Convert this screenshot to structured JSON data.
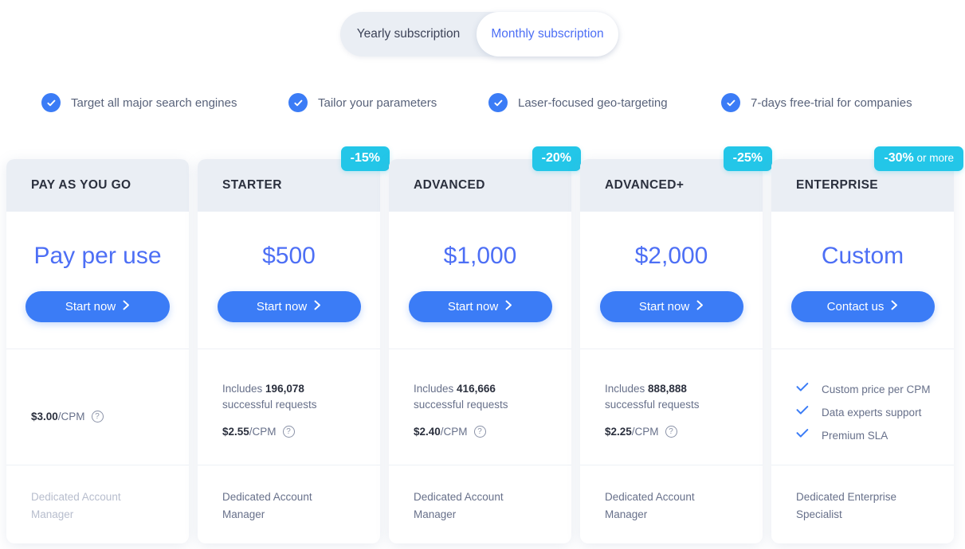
{
  "billing_toggle": {
    "options": [
      {
        "label": "Yearly subscription",
        "active": false
      },
      {
        "label": "Monthly subscription",
        "active": true
      }
    ]
  },
  "features": [
    {
      "icon": "check-circle-icon",
      "label": "Target all major search engines"
    },
    {
      "icon": "check-circle-icon",
      "label": "Tailor your parameters"
    },
    {
      "icon": "check-circle-icon",
      "label": "Laser-focused geo-targeting"
    },
    {
      "icon": "check-circle-icon",
      "label": "7-days free-trial for companies"
    }
  ],
  "plans": [
    {
      "name": "PAY AS YOU GO",
      "badge": null,
      "badge_suffix": null,
      "price": "Pay per use",
      "cta": "Start now",
      "includes_prefix": null,
      "includes_amount": null,
      "includes_suffix": null,
      "cpm_price": "$3.00",
      "cpm_unit": "/CPM",
      "footer": "Dedicated Account Manager",
      "footer_disabled": true
    },
    {
      "name": "STARTER",
      "badge": "-15%",
      "badge_suffix": null,
      "price": "$500",
      "cta": "Start now",
      "includes_prefix": "Includes ",
      "includes_amount": "196,078",
      "includes_suffix": "successful requests",
      "cpm_price": "$2.55",
      "cpm_unit": "/CPM",
      "footer": "Dedicated Account Manager",
      "footer_disabled": false
    },
    {
      "name": "ADVANCED",
      "badge": "-20%",
      "badge_suffix": null,
      "price": "$1,000",
      "cta": "Start now",
      "includes_prefix": "Includes ",
      "includes_amount": "416,666",
      "includes_suffix": "successful requests",
      "cpm_price": "$2.40",
      "cpm_unit": "/CPM",
      "footer": "Dedicated Account Manager",
      "footer_disabled": false
    },
    {
      "name": "ADVANCED+",
      "badge": "-25%",
      "badge_suffix": null,
      "price": "$2,000",
      "cta": "Start now",
      "includes_prefix": "Includes ",
      "includes_amount": "888,888",
      "includes_suffix": "successful requests",
      "cpm_price": "$2.25",
      "cpm_unit": "/CPM",
      "footer": "Dedicated Account Manager",
      "footer_disabled": false
    },
    {
      "name": "ENTERPRISE",
      "badge": "-30%",
      "badge_suffix": " or more",
      "price": "Custom",
      "cta": "Contact us",
      "enterprise_features": [
        "Custom price per CPM",
        "Data experts support",
        "Premium SLA"
      ],
      "footer": "Dedicated Enterprise Specialist",
      "footer_disabled": false
    }
  ],
  "colors": {
    "accent_blue": "#3b7cf6",
    "price_blue": "#4d6ff5",
    "badge_cyan": "#23c6e8",
    "header_gray": "#eaeef4",
    "text_muted": "#67708a",
    "text_dark": "#2b303e"
  },
  "icons": {
    "check_circle": "check-circle-icon",
    "chevron_right": "chevron-right-icon",
    "question": "question-mark-icon",
    "tick": "check-icon"
  }
}
